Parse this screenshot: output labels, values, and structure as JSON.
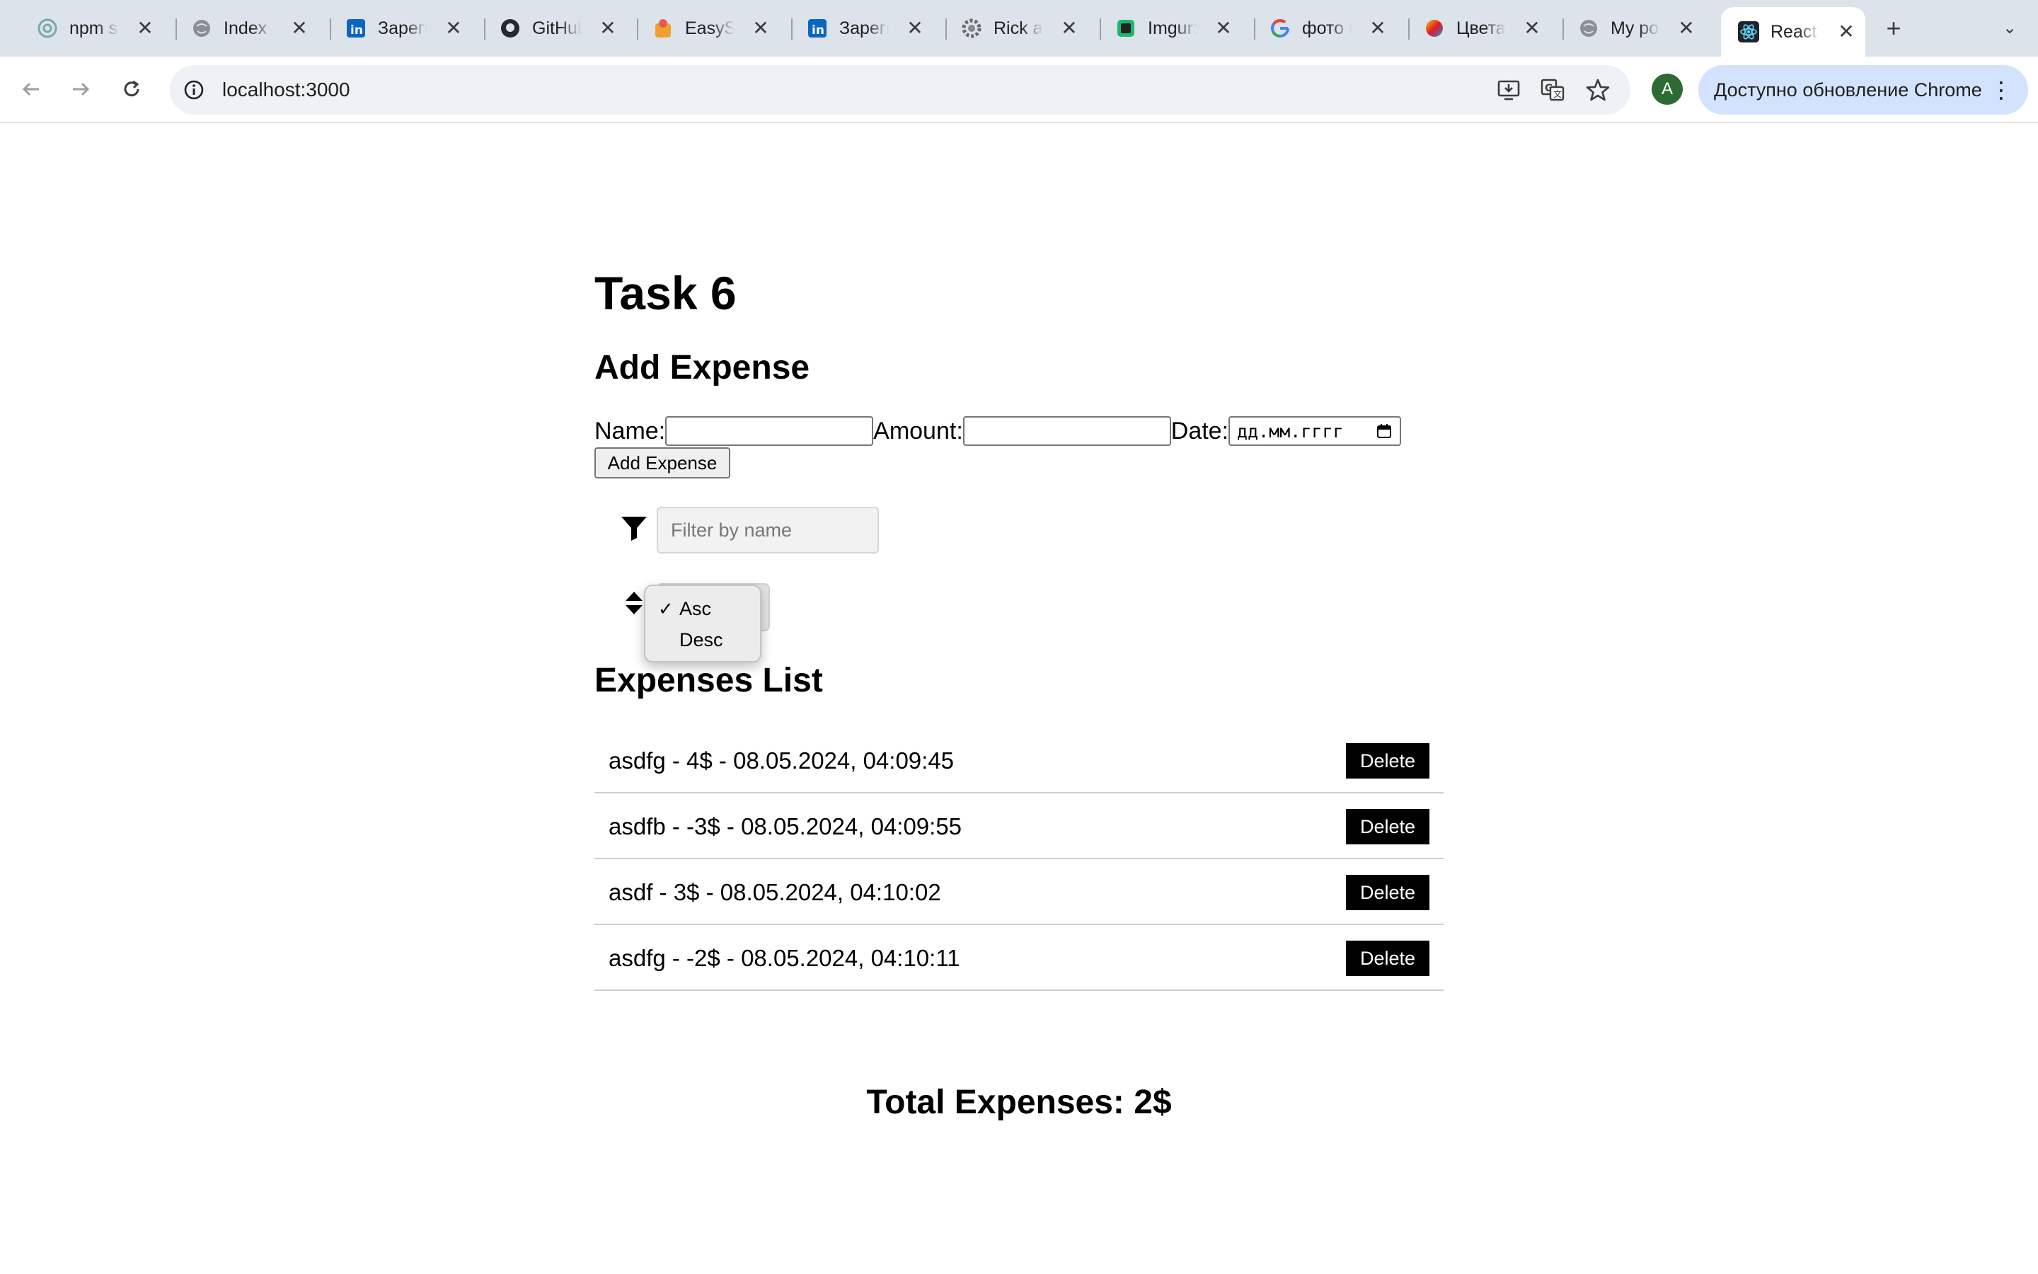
{
  "browser": {
    "tabs": [
      {
        "title": "npm st",
        "icon": "openai-icon",
        "active": false
      },
      {
        "title": "Index c",
        "icon": "globe-icon",
        "active": false
      },
      {
        "title": "Зареги",
        "icon": "linkedin-icon",
        "active": false
      },
      {
        "title": "GitHub",
        "icon": "github-icon",
        "active": false
      },
      {
        "title": "EasySh",
        "icon": "easyshare-icon",
        "active": false
      },
      {
        "title": "Зареги",
        "icon": "linkedin-icon",
        "active": false
      },
      {
        "title": "Rick ar",
        "icon": "gear-icon",
        "active": false
      },
      {
        "title": "Imgur:",
        "icon": "imgur-icon",
        "active": false
      },
      {
        "title": "фото к",
        "icon": "google-icon",
        "active": false
      },
      {
        "title": "Цвета",
        "icon": "color-wheel-icon",
        "active": false
      },
      {
        "title": "My por",
        "icon": "globe-icon",
        "active": false
      },
      {
        "title": "React",
        "icon": "react-icon",
        "active": true
      }
    ],
    "new_tab_label": "+",
    "url": "localhost:3000",
    "avatar_letter": "A",
    "update_label": "Доступно обновление Chrome"
  },
  "page": {
    "title": "Task 6",
    "add_section_title": "Add Expense",
    "form": {
      "name_label": "Name:",
      "amount_label": "Amount:",
      "date_label": "Date:",
      "date_placeholder": "дд.мм.гггг",
      "submit_label": "Add Expense"
    },
    "filter": {
      "placeholder": "Filter by name",
      "value": ""
    },
    "sort": {
      "options": [
        "Asc",
        "Desc"
      ],
      "selected": "Asc",
      "check": "✓"
    },
    "list_title": "Expenses List",
    "expenses": [
      {
        "text": "asdfg - 4$ - 08.05.2024, 04:09:45",
        "delete_label": "Delete"
      },
      {
        "text": "asdfb - -3$ - 08.05.2024, 04:09:55",
        "delete_label": "Delete"
      },
      {
        "text": "asdf - 3$ - 08.05.2024, 04:10:02",
        "delete_label": "Delete"
      },
      {
        "text": "asdfg - -2$ - 08.05.2024, 04:10:11",
        "delete_label": "Delete"
      }
    ],
    "total": "Total Expenses: 2$"
  },
  "colors": {
    "tabstrip": "#dde3ea",
    "omnibox": "#eef1f5",
    "update_button": "#d3e3fd",
    "delete_button": "#000000",
    "avatar": "#2e6b34"
  }
}
